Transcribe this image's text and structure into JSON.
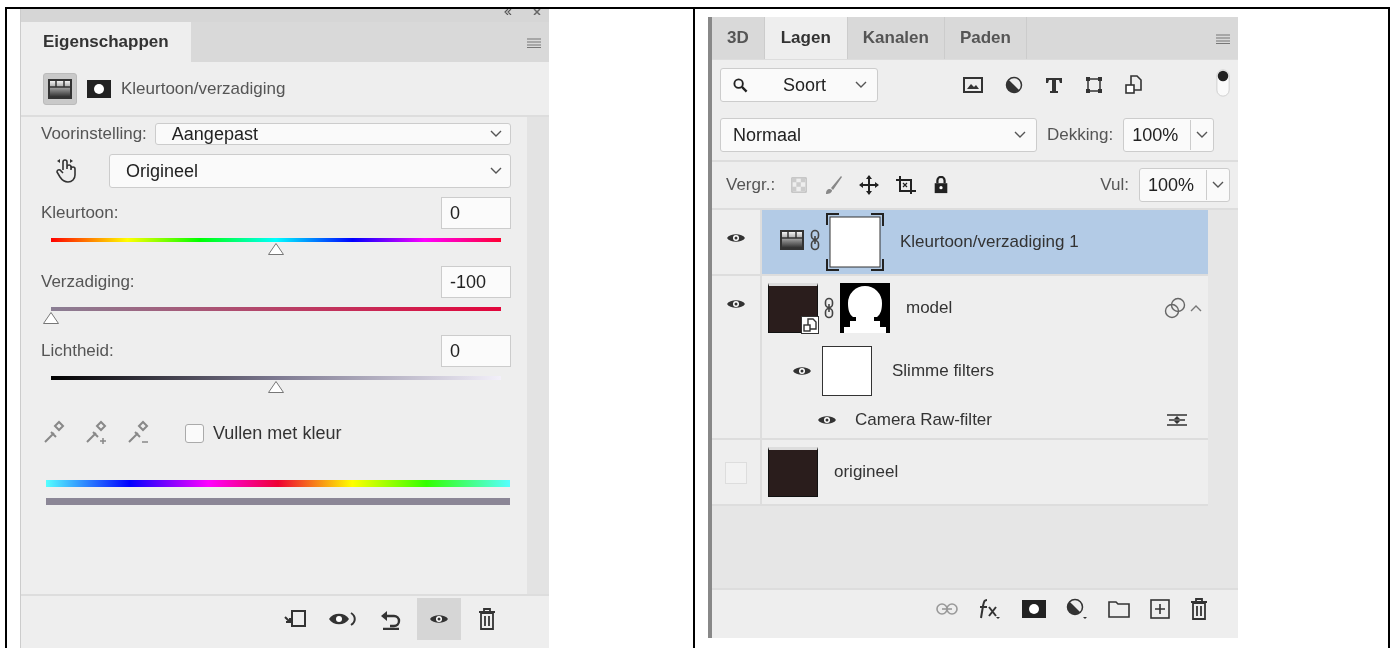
{
  "properties_panel": {
    "tab": "Eigenschappen",
    "title": "Kleurtoon/verzadiging",
    "preset": {
      "label": "Voorinstelling:",
      "value": "Aangepast"
    },
    "channel": {
      "value": "Origineel"
    },
    "sliders": [
      {
        "kind": "hue",
        "label": "Kleurtoon:",
        "value": "0",
        "level": 0.5
      },
      {
        "kind": "saturation",
        "label": "Verzadiging:",
        "value": "-100",
        "level": 0
      },
      {
        "kind": "lightness",
        "label": "Lichtheid:",
        "value": "0",
        "level": 0.5
      }
    ],
    "colorize": {
      "label": "Vullen met kleur",
      "checked": false
    }
  },
  "layers_panel": {
    "tabs": [
      {
        "label": "3D",
        "selected": false
      },
      {
        "label": "Lagen",
        "selected": true
      },
      {
        "label": "Kanalen",
        "selected": false
      },
      {
        "label": "Paden",
        "selected": false
      }
    ],
    "filter": {
      "value": "Soort"
    },
    "blend_mode": "Normaal",
    "opacity": {
      "label": "Dekking:",
      "value": "100%"
    },
    "lock_label": "Vergr.:",
    "fill": {
      "label": "Vul:",
      "value": "100%"
    },
    "layers": [
      {
        "kind": "adjustment",
        "name": "Kleurtoon/verzadiging 1",
        "visible": true,
        "selected": true
      },
      {
        "kind": "smart-object",
        "name": "model",
        "visible": true,
        "selected": false,
        "children": [
          {
            "kind": "smart-filters",
            "name": "Slimme filters",
            "visible": true,
            "children": [
              {
                "kind": "filter",
                "name": "Camera Raw-filter",
                "visible": true
              }
            ]
          }
        ]
      },
      {
        "kind": "photo",
        "name": "origineel",
        "visible": false,
        "selected": false
      }
    ]
  }
}
